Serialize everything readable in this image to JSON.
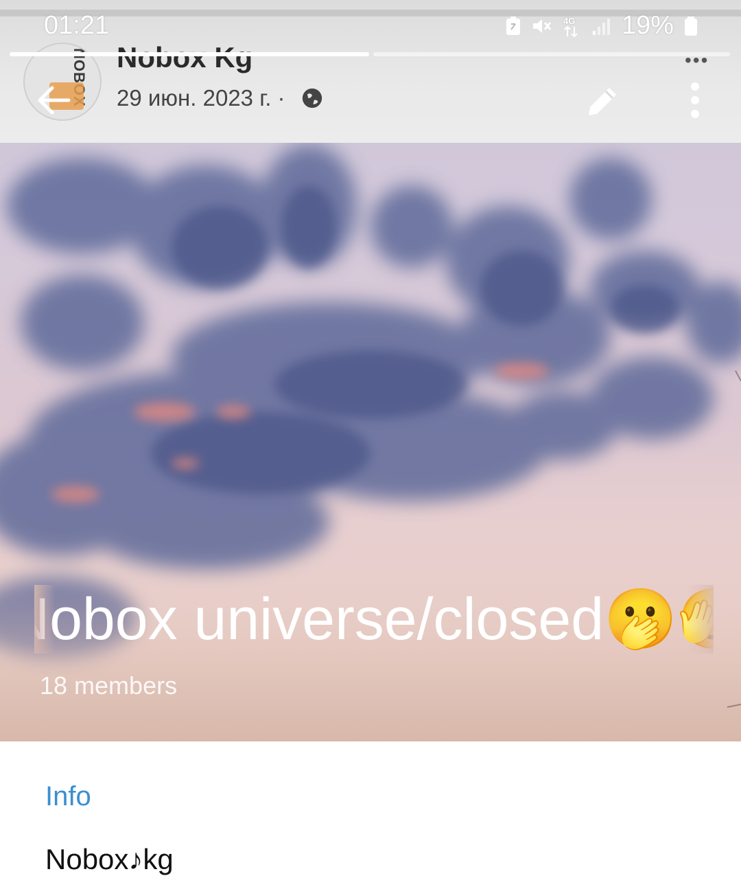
{
  "status_bar": {
    "time": "01:21",
    "network": "4G",
    "battery_percent": "19%",
    "icons": [
      "battery-saver-icon",
      "mute-icon",
      "network-4g-icon",
      "signal-icon",
      "battery-icon"
    ]
  },
  "story": {
    "progress_active_fraction": 0.5
  },
  "background_post": {
    "page_name": "Nobox Kg",
    "date": "29 июн. 2023 г. ·",
    "avatar_logo": "NOBOX",
    "more": "•••"
  },
  "toolbar": {
    "icons": [
      "back-arrow-icon",
      "edit-pencil-icon",
      "more-vert-icon"
    ]
  },
  "group": {
    "title": "Nobox universe/closed🫢🫣    Nobox universe/closed",
    "members": "18 members"
  },
  "info": {
    "header": "Info",
    "value": "Nobox♪kg"
  },
  "colors": {
    "accent": "#3a8fd0",
    "text_primary": "#111111"
  }
}
